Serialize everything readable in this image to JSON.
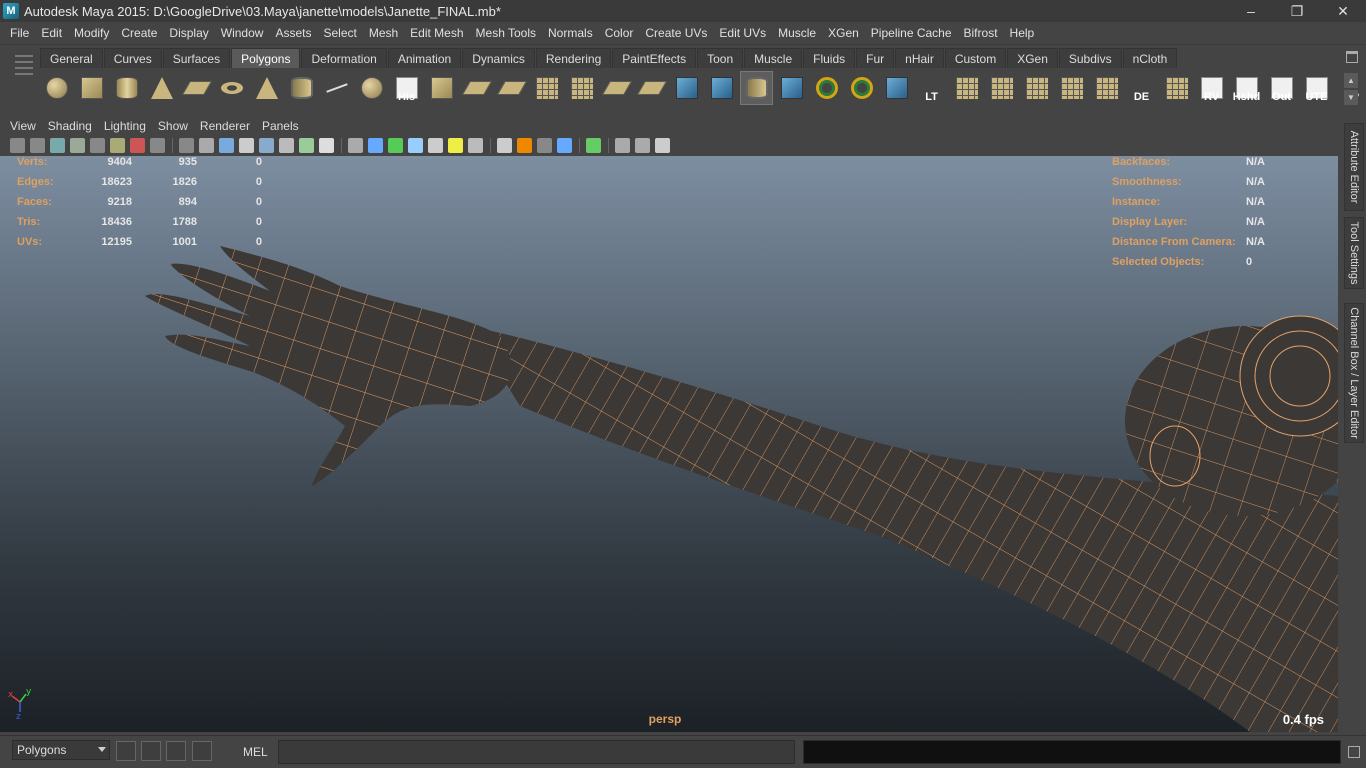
{
  "window": {
    "title": "Autodesk Maya 2015: D:\\GoogleDrive\\03.Maya\\janette\\models\\Janette_FINAL.mb*",
    "minimize": "–",
    "maximize": "❐",
    "close": "✕"
  },
  "menubar": [
    "File",
    "Edit",
    "Modify",
    "Create",
    "Display",
    "Window",
    "Assets",
    "Select",
    "Mesh",
    "Edit Mesh",
    "Mesh Tools",
    "Normals",
    "Color",
    "Create UVs",
    "Edit UVs",
    "Muscle",
    "XGen",
    "Pipeline Cache",
    "Bifrost",
    "Help"
  ],
  "shelf": {
    "tabs": [
      "General",
      "Curves",
      "Surfaces",
      "Polygons",
      "Deformation",
      "Animation",
      "Dynamics",
      "Rendering",
      "PaintEffects",
      "Toon",
      "Muscle",
      "Fluids",
      "Fur",
      "nHair",
      "Custom",
      "XGen",
      "Subdivs",
      "nCloth"
    ],
    "active_tab": "Polygons",
    "icons": [
      {
        "name": "poly-sphere-icon",
        "shape": "sphere",
        "label": ""
      },
      {
        "name": "poly-cube-icon",
        "shape": "cube",
        "label": ""
      },
      {
        "name": "poly-cylinder-icon",
        "shape": "cyl",
        "label": ""
      },
      {
        "name": "poly-cone-icon",
        "shape": "cone",
        "label": ""
      },
      {
        "name": "poly-plane-icon",
        "shape": "plane",
        "label": ""
      },
      {
        "name": "poly-torus-icon",
        "shape": "torus",
        "label": ""
      },
      {
        "name": "poly-pyramid-icon",
        "shape": "cone",
        "label": ""
      },
      {
        "name": "poly-pipe-icon",
        "shape": "pipe",
        "label": ""
      },
      {
        "name": "create-polygon-icon",
        "shape": "line",
        "label": ""
      },
      {
        "name": "combine-icon",
        "shape": "sphere",
        "label": ""
      },
      {
        "name": "history-icon",
        "shape": "white",
        "label": "His"
      },
      {
        "name": "extrude-icon",
        "shape": "cube",
        "label": ""
      },
      {
        "name": "bridge-icon",
        "shape": "plane",
        "label": ""
      },
      {
        "name": "append-polygon-icon",
        "shape": "plane",
        "label": ""
      },
      {
        "name": "split-polygon-icon",
        "shape": "grid",
        "label": ""
      },
      {
        "name": "insert-edge-loop-icon",
        "shape": "grid",
        "label": ""
      },
      {
        "name": "offset-edge-loop-icon",
        "shape": "plane",
        "label": ""
      },
      {
        "name": "slide-edge-icon",
        "shape": "plane",
        "label": ""
      },
      {
        "name": "merge-vertices-icon",
        "shape": "blue",
        "label": ""
      },
      {
        "name": "sculpt-icon",
        "shape": "blue",
        "label": ""
      },
      {
        "name": "paint-tool-icon",
        "shape": "pipe",
        "label": ""
      },
      {
        "name": "wireframe-cube-icon",
        "shape": "blue",
        "label": ""
      },
      {
        "name": "soft-select-icon",
        "shape": "ring",
        "label": ""
      },
      {
        "name": "rotate-manip-icon",
        "shape": "ring",
        "label": ""
      },
      {
        "name": "move-manip-icon",
        "shape": "blue",
        "label": ""
      },
      {
        "name": "lt-icon",
        "shape": "none",
        "label": "LT"
      },
      {
        "name": "uv-layout-icon",
        "shape": "grid",
        "label": ""
      },
      {
        "name": "uv-unfold-icon",
        "shape": "grid",
        "label": ""
      },
      {
        "name": "uv-select-icon",
        "shape": "grid",
        "label": ""
      },
      {
        "name": "uv-cut-icon",
        "shape": "grid",
        "label": ""
      },
      {
        "name": "uv-sew-icon",
        "shape": "grid",
        "label": ""
      },
      {
        "name": "de-icon",
        "shape": "none",
        "label": "DE"
      },
      {
        "name": "uv-grid-icon",
        "shape": "grid",
        "label": ""
      },
      {
        "name": "rv-icon",
        "shape": "white",
        "label": "RV"
      },
      {
        "name": "hshd-icon",
        "shape": "white",
        "label": "Hshd"
      },
      {
        "name": "out-icon",
        "shape": "white",
        "label": "Out"
      },
      {
        "name": "ute-icon",
        "shape": "white",
        "label": "UTE"
      },
      {
        "name": "cp-icon",
        "shape": "none",
        "label": "CP"
      }
    ]
  },
  "panel_menu": [
    "View",
    "Shading",
    "Lighting",
    "Show",
    "Renderer",
    "Panels"
  ],
  "hud_left": [
    {
      "label": "Verts:",
      "v1": "9404",
      "v2": "935",
      "v3": "0"
    },
    {
      "label": "Edges:",
      "v1": "18623",
      "v2": "1826",
      "v3": "0"
    },
    {
      "label": "Faces:",
      "v1": "9218",
      "v2": "894",
      "v3": "0"
    },
    {
      "label": "Tris:",
      "v1": "18436",
      "v2": "1788",
      "v3": "0"
    },
    {
      "label": "UVs:",
      "v1": "12195",
      "v2": "1001",
      "v3": "0"
    }
  ],
  "hud_right": [
    {
      "label": "Backfaces:",
      "value": "N/A"
    },
    {
      "label": "Smoothness:",
      "value": "N/A"
    },
    {
      "label": "Instance:",
      "value": "N/A"
    },
    {
      "label": "Display Layer:",
      "value": "N/A"
    },
    {
      "label": "Distance From Camera:",
      "value": "N/A"
    },
    {
      "label": "Selected Objects:",
      "value": "0"
    }
  ],
  "viewport": {
    "camera": "persp",
    "fps": "0.4 fps",
    "axis_x": "x",
    "axis_y": "y",
    "axis_z": "z"
  },
  "side_tabs": [
    "Attribute Editor",
    "Tool Settings",
    "Channel Box / Layer Editor"
  ],
  "bottom": {
    "mode": "Polygons",
    "mel_label": "MEL"
  },
  "colors": {
    "hud_label": "#e0a060",
    "wire": "#e8a26a",
    "mesh": "#3b3835"
  }
}
